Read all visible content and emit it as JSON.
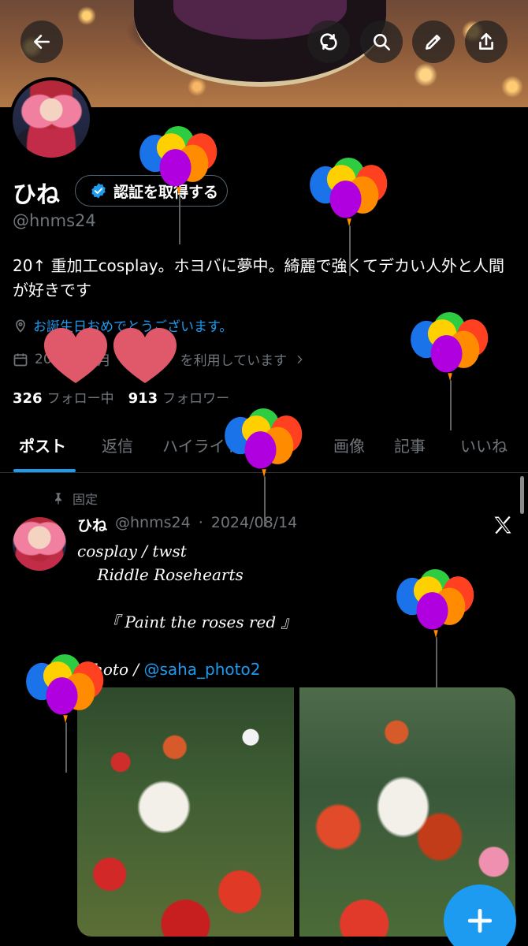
{
  "profile": {
    "name": "ひね",
    "handle": "@hnms24",
    "verify_label": "認証を取得する",
    "bio": "20↑ 重加工cosplay。ホヨバに夢中。綺麗で強くてデカい人外と人間が好きです",
    "birthday_text": "お誕生日おめでとうございます。",
    "joined_prefix": "20",
    "joined_mid": "月",
    "joined_suffix": "を利用しています",
    "following_count": "326",
    "following_label": "フォロー中",
    "followers_count": "913",
    "followers_label": "フォロワー"
  },
  "tabs": [
    "ポスト",
    "返信",
    "ハイライト",
    "画像",
    "記事",
    "いいね"
  ],
  "post": {
    "pinned_label": "固定",
    "author_name": "ひね",
    "author_handle": "@hnms24",
    "date": "2024/08/14",
    "line1": "cosplay / twst",
    "line2": "    Riddle Rosehearts",
    "line3": "『 Paint the roses red 』",
    "line4_prefix": "hoto / ",
    "mention": "@saha_photo2"
  },
  "colors": {
    "accent": "#1d9bf0",
    "background": "#000000",
    "secondary_text": "#71767b"
  },
  "icons": [
    "back-arrow-icon",
    "refresh-icon",
    "search-icon",
    "edit-icon",
    "share-icon",
    "verified-badge-icon",
    "location-icon",
    "calendar-icon",
    "chevron-right-icon",
    "pin-icon",
    "x-logo-icon",
    "plus-icon",
    "balloons-sticker",
    "heart-sticker"
  ]
}
